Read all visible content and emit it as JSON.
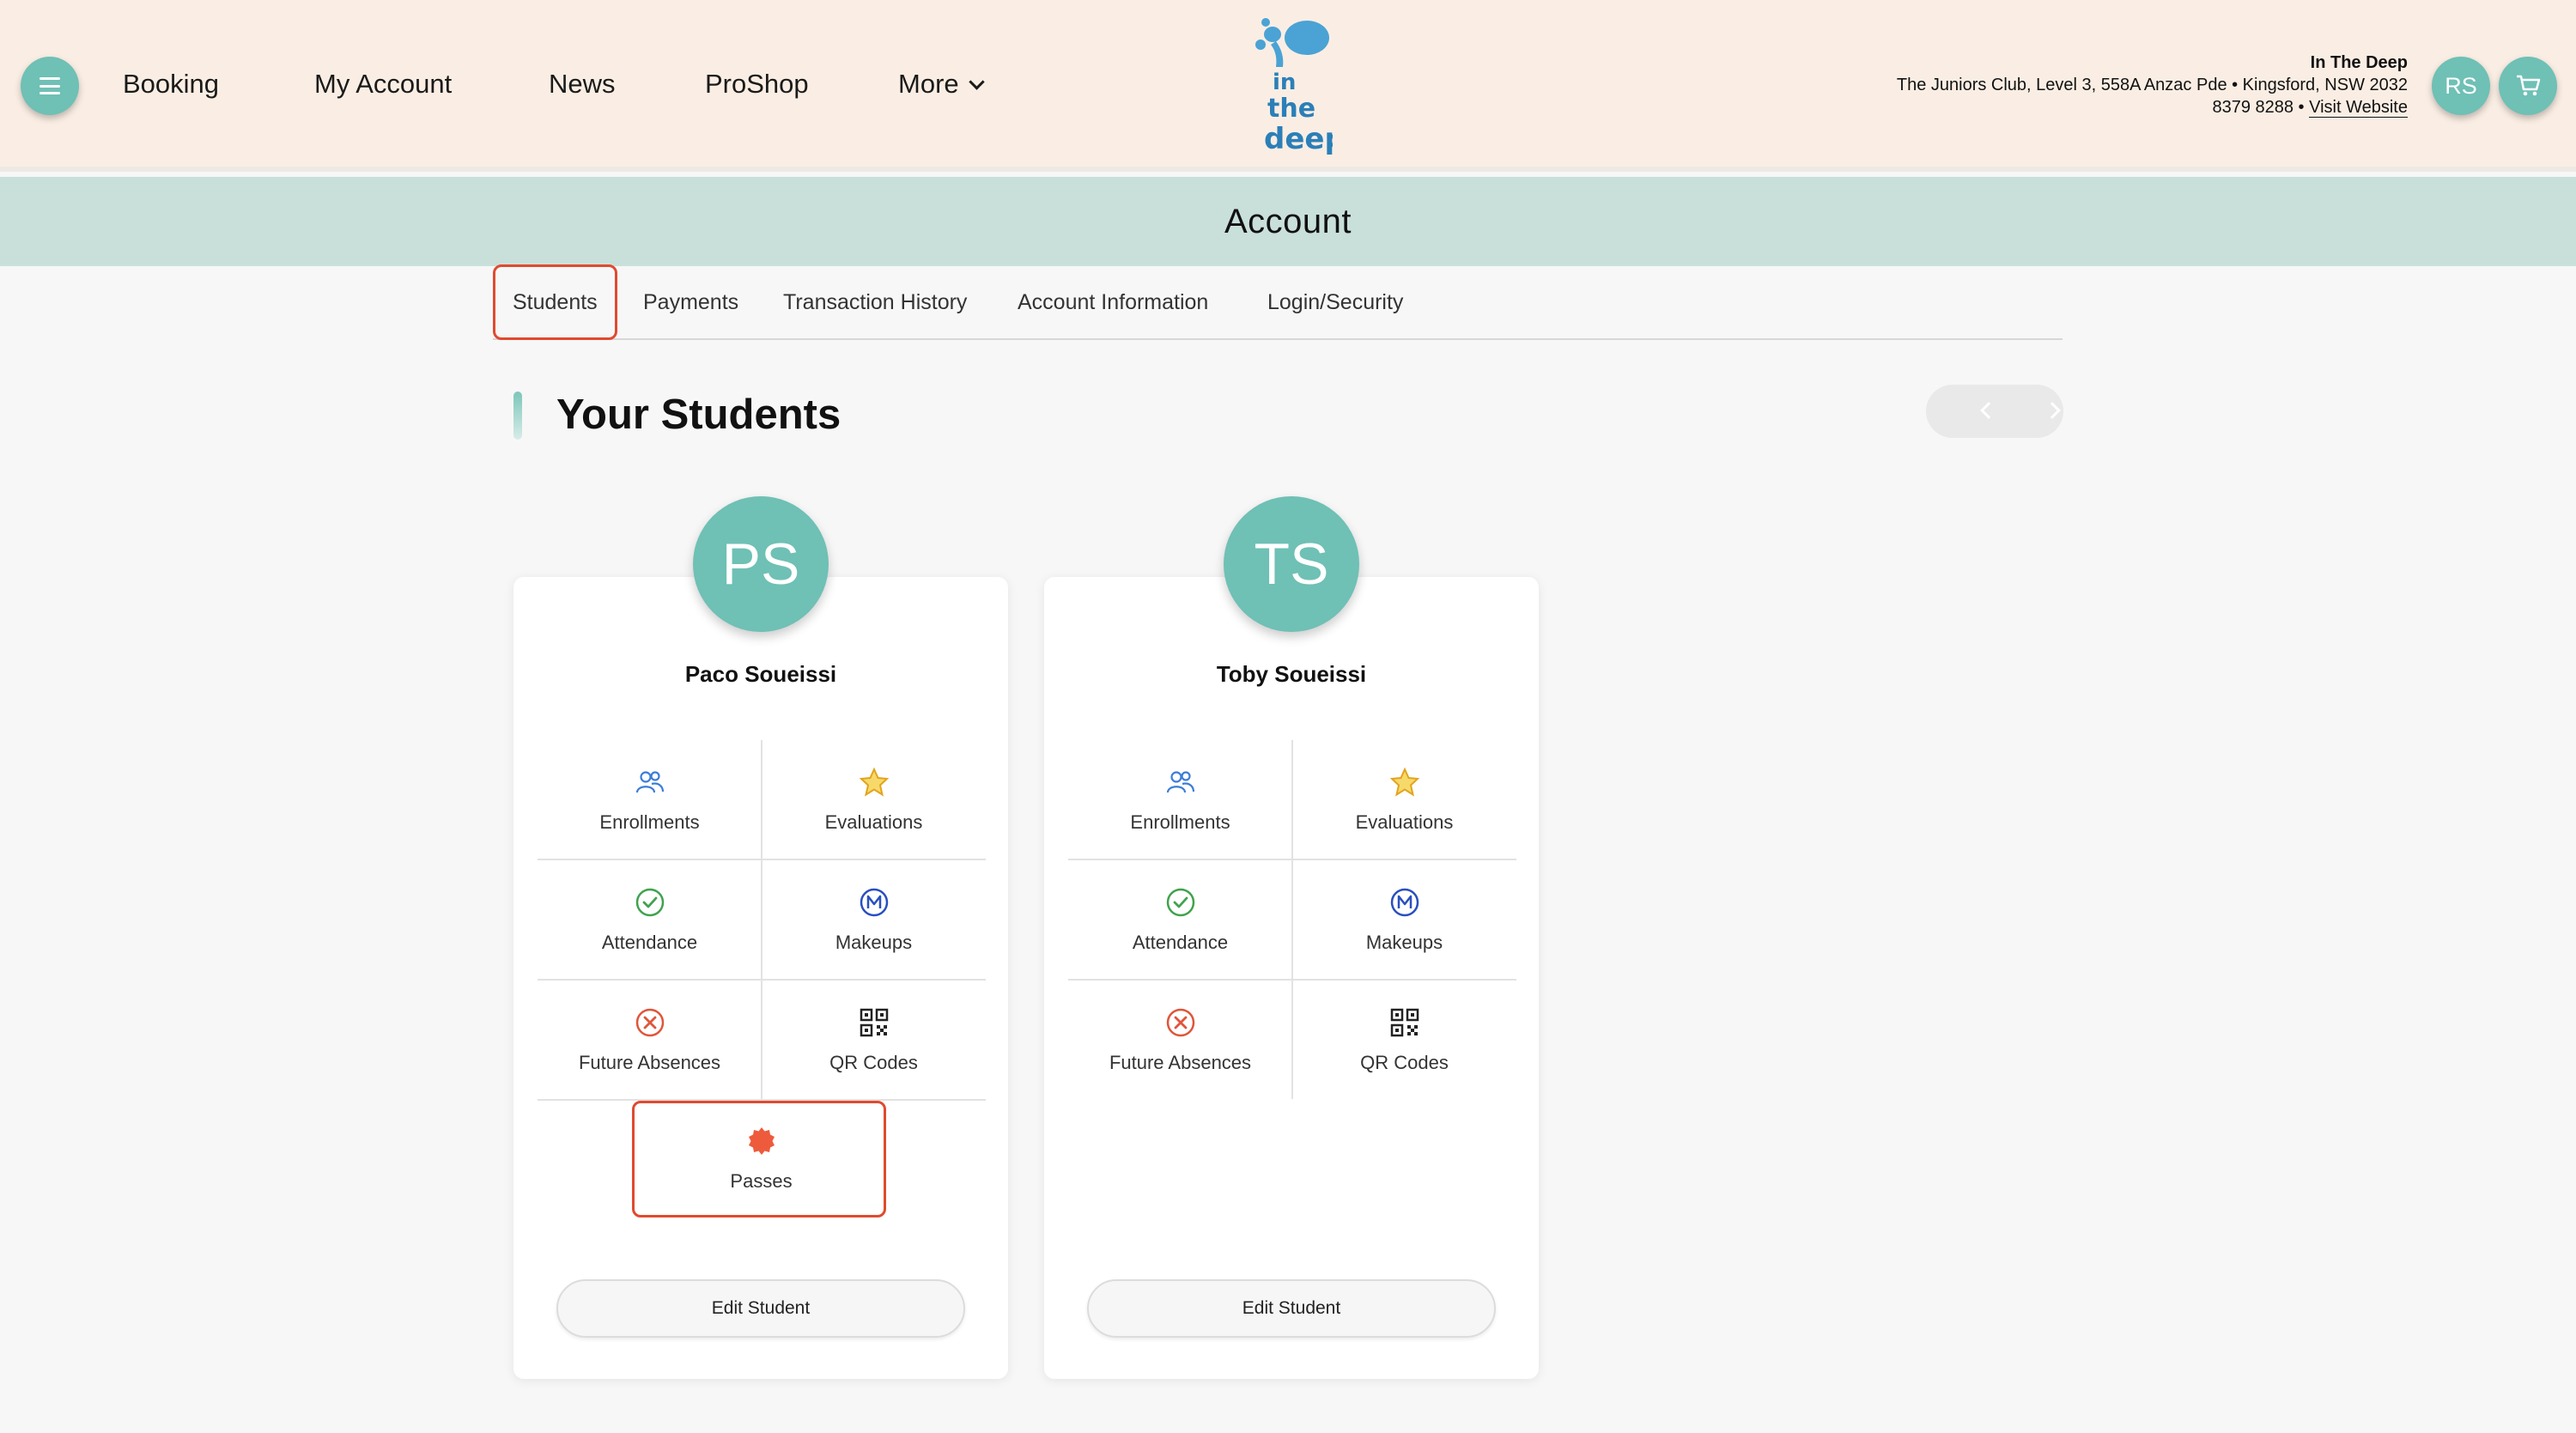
{
  "nav": {
    "items": [
      {
        "label": "Booking"
      },
      {
        "label": "My Account"
      },
      {
        "label": "News"
      },
      {
        "label": "ProShop"
      },
      {
        "label": "More"
      }
    ]
  },
  "logo": {
    "text": "in the deep"
  },
  "org": {
    "name": "In The Deep",
    "address": "The Juniors Club, Level 3, 558A Anzac Pde • Kingsford, NSW 2032",
    "phone": "8379 8288 •",
    "visit_label": "Visit Website"
  },
  "user": {
    "initials": "RS"
  },
  "page": {
    "title": "Account"
  },
  "tabs": [
    {
      "label": "Students"
    },
    {
      "label": "Payments"
    },
    {
      "label": "Transaction History"
    },
    {
      "label": "Account Information"
    },
    {
      "label": "Login/Security"
    }
  ],
  "section": {
    "title": "Your Students"
  },
  "students": [
    {
      "initials": "PS",
      "name": "Paco Soueissi",
      "actions": [
        {
          "label": "Enrollments",
          "icon": "people-icon"
        },
        {
          "label": "Evaluations",
          "icon": "star-icon"
        },
        {
          "label": "Attendance",
          "icon": "check-circle-icon"
        },
        {
          "label": "Makeups",
          "icon": "makeup-icon"
        },
        {
          "label": "Future Absences",
          "icon": "x-circle-icon"
        },
        {
          "label": "QR Codes",
          "icon": "qr-code-icon"
        },
        {
          "label": "Passes",
          "icon": "badge-icon"
        }
      ],
      "edit_label": "Edit Student"
    },
    {
      "initials": "TS",
      "name": "Toby Soueissi",
      "actions": [
        {
          "label": "Enrollments",
          "icon": "people-icon"
        },
        {
          "label": "Evaluations",
          "icon": "star-icon"
        },
        {
          "label": "Attendance",
          "icon": "check-circle-icon"
        },
        {
          "label": "Makeups",
          "icon": "makeup-icon"
        },
        {
          "label": "Future Absences",
          "icon": "x-circle-icon"
        },
        {
          "label": "QR Codes",
          "icon": "qr-code-icon"
        }
      ],
      "edit_label": "Edit Student"
    }
  ],
  "colors": {
    "header_bg": "#faeee4",
    "accent_teal": "#6fc0b5",
    "band_bg": "#c9e0da",
    "highlight_red": "#e04a2f"
  }
}
